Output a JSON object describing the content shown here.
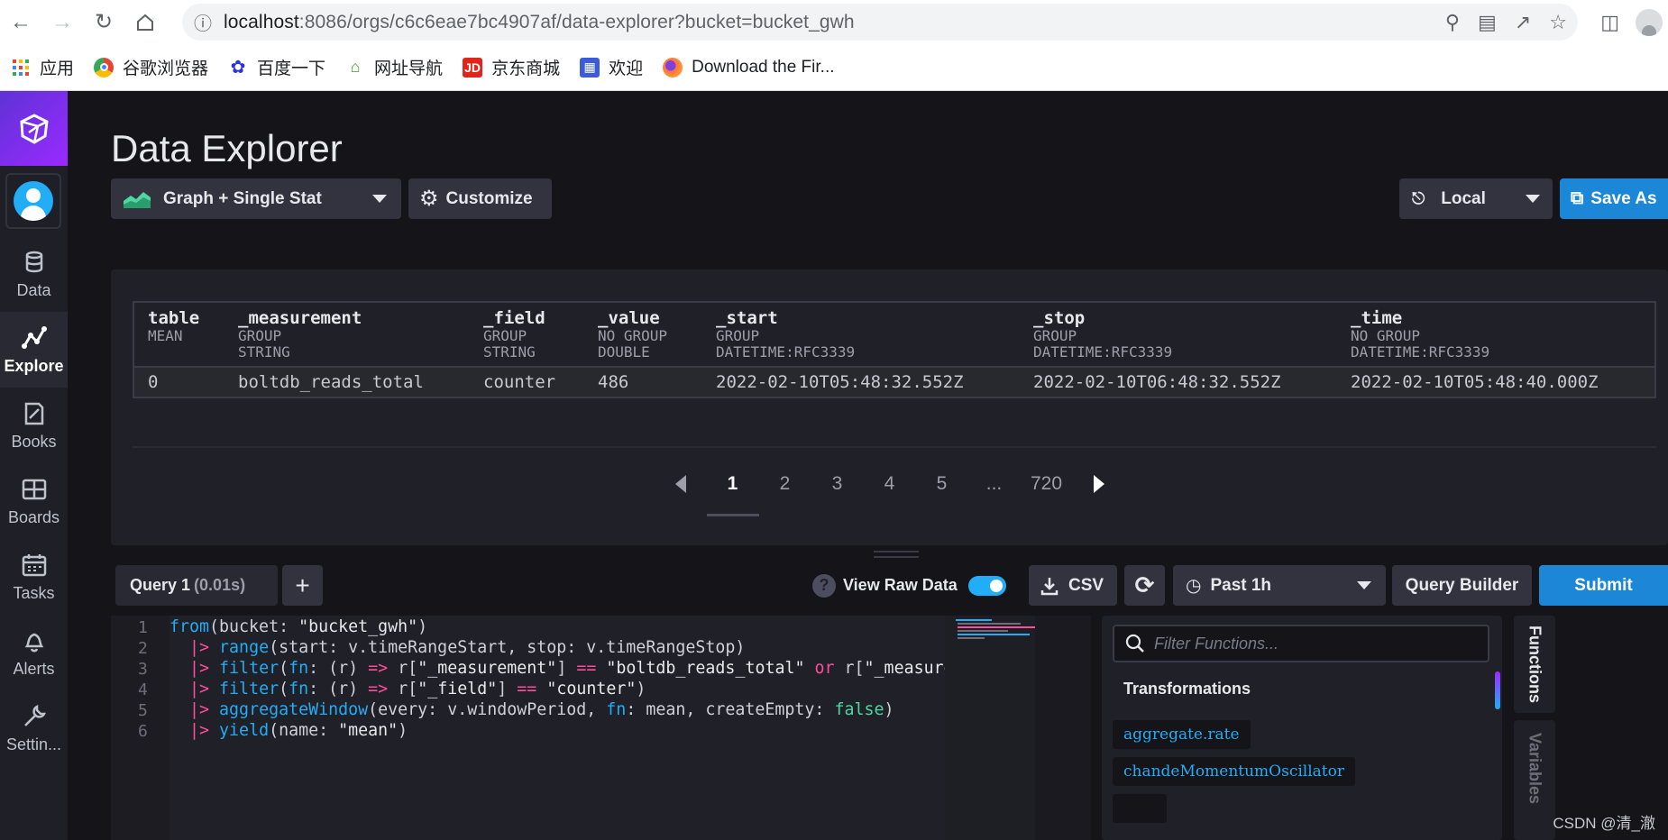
{
  "browser": {
    "url_host": "localhost",
    "url_path": ":8086/orgs/c6c6eae7bc4907af/data-explorer?bucket=bucket_gwh",
    "bookmarks": [
      {
        "label": "应用",
        "icon": "apps-grid-icon"
      },
      {
        "label": "谷歌浏览器",
        "icon": "chrome-icon"
      },
      {
        "label": "百度一下",
        "icon": "baidu-paw-icon"
      },
      {
        "label": "网址导航",
        "icon": "2345-nav-icon"
      },
      {
        "label": "京东商城",
        "icon": "jd-icon"
      },
      {
        "label": "欢迎",
        "icon": "welcome-icon"
      },
      {
        "label": "Download the Fir...",
        "icon": "firefox-icon"
      }
    ]
  },
  "sidebar": {
    "items": [
      {
        "label": "Data",
        "icon": "database-icon"
      },
      {
        "label": "Explore",
        "icon": "graph-icon",
        "active": true
      },
      {
        "label": "Books",
        "icon": "notebook-icon"
      },
      {
        "label": "Boards",
        "icon": "dashboard-grid-icon"
      },
      {
        "label": "Tasks",
        "icon": "calendar-icon"
      },
      {
        "label": "Alerts",
        "icon": "bell-icon"
      },
      {
        "label": "Settin...",
        "icon": "wrench-icon"
      }
    ]
  },
  "page": {
    "title": "Data Explorer"
  },
  "toolbar": {
    "graph_type": "Graph + Single Stat",
    "customize": "Customize",
    "timezone": "Local",
    "save_as": "Save As"
  },
  "results": {
    "columns": [
      {
        "name": "table",
        "group": "MEAN",
        "type": ""
      },
      {
        "name": "_measurement",
        "group": "GROUP",
        "type": "STRING"
      },
      {
        "name": "_field",
        "group": "GROUP",
        "type": "STRING"
      },
      {
        "name": "_value",
        "group": "NO GROUP",
        "type": "DOUBLE"
      },
      {
        "name": "_start",
        "group": "GROUP",
        "type": "DATETIME:RFC3339"
      },
      {
        "name": "_stop",
        "group": "GROUP",
        "type": "DATETIME:RFC3339"
      },
      {
        "name": "_time",
        "group": "NO GROUP",
        "type": "DATETIME:RFC3339"
      }
    ],
    "row": [
      "0",
      "boltdb_reads_total",
      "counter",
      "486",
      "2022-02-10T05:48:32.552Z",
      "2022-02-10T06:48:32.552Z",
      "2022-02-10T05:48:40.000Z"
    ],
    "pagination": [
      "1",
      "2",
      "3",
      "4",
      "5",
      "...",
      "720"
    ],
    "current_page": "1"
  },
  "query": {
    "tab_label": "Query 1",
    "tab_time": "(0.01s)",
    "add": "+",
    "view_raw": "View Raw Data",
    "raw_enabled": true,
    "csv": "CSV",
    "time_range": "Past 1h",
    "query_builder": "Query Builder",
    "submit": "Submit"
  },
  "editor": {
    "line_numbers": [
      "1",
      "2",
      "3",
      "4",
      "5",
      "6"
    ]
  },
  "functions": {
    "placeholder": "Filter Functions...",
    "heading": "Transformations",
    "items": [
      "aggregate.rate",
      "chandeMomentumOscillator"
    ]
  },
  "vtabs": {
    "functions": "Functions",
    "variables": "Variables"
  },
  "watermark": "CSDN @清_澈",
  "colors": {
    "accent_blue": "#22adf6",
    "accent_purple": "#9b2aff",
    "background": "#141419",
    "keyword_pink": "#ff4d9e",
    "bool_green": "#4ed8a0"
  }
}
